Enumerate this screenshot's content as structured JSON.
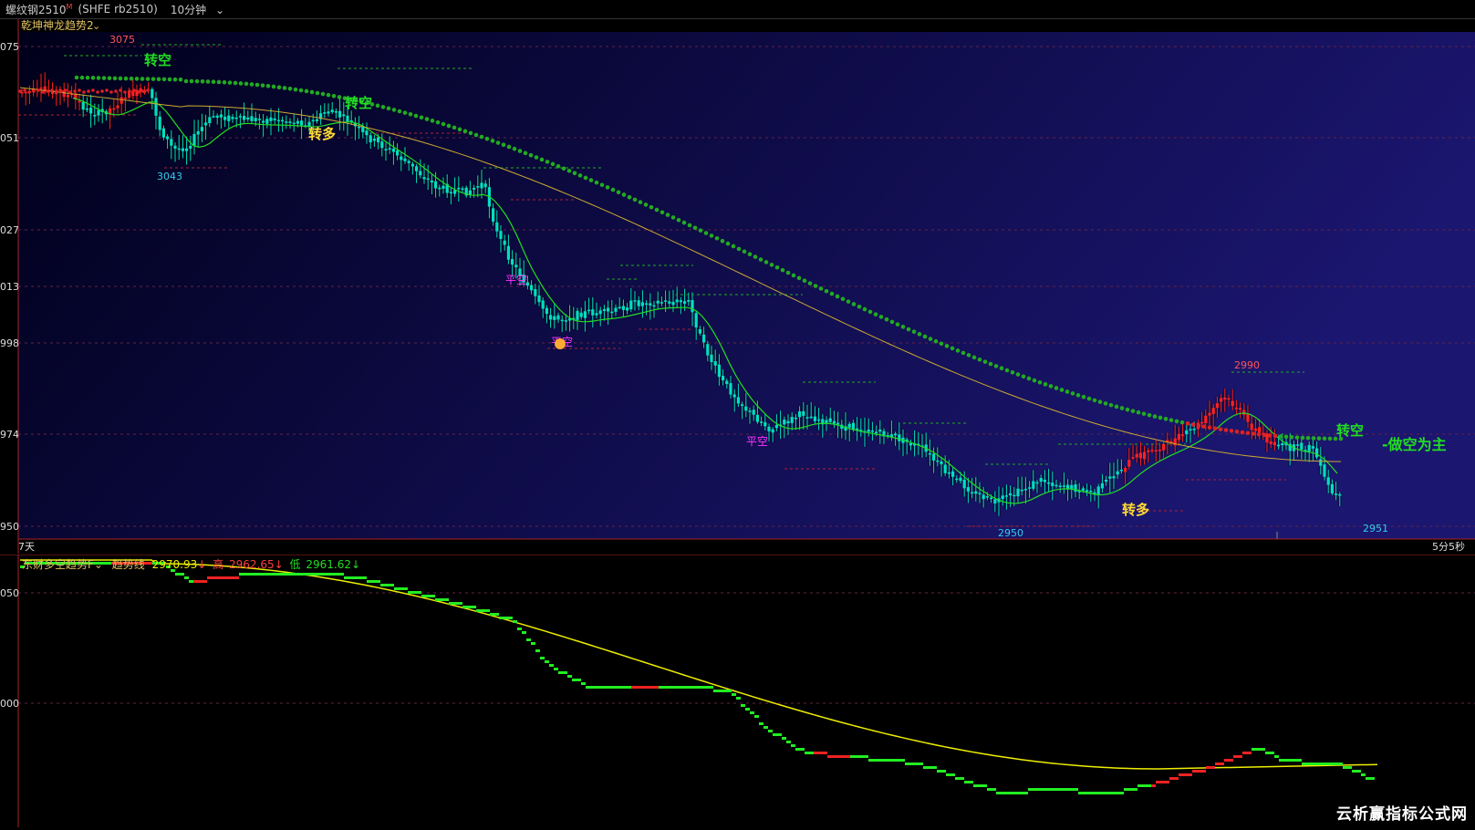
{
  "header": {
    "symbol": "螺纹钢2510",
    "symbol_sup": "M",
    "code": "(SHFE rb2510)",
    "interval": "10分钟"
  },
  "main_indicator": {
    "name": "乾坤神龙趋势2",
    "price_axis": [
      "075",
      "051",
      "027",
      "013",
      "998",
      "974",
      "950"
    ],
    "left_bottom_label": "7天",
    "right_bottom_label": "5分5秒",
    "annotations": {
      "high_label": "3075",
      "low1_label": "3043",
      "low2_label": "2950",
      "high2_label": "2990",
      "last_low_label": "2951",
      "zhuankong_1": "转空",
      "zhuankong_2": "转空",
      "zhuankong_3": "转空",
      "zhuanduo_1": "转多",
      "zhuanduo_2": "转多",
      "pingkong_1": "平空",
      "pingkong_2": "平空",
      "pingkong_3": "平空",
      "zuokong": "-做空为主"
    }
  },
  "sub_indicator": {
    "name": "东财多空趋势F",
    "line_label": "趋势线",
    "line_value": "2970.93",
    "high_label": "高",
    "high_value": "2962.65",
    "low_label": "低",
    "low_value": "2961.62",
    "price_axis": [
      "050",
      "000"
    ]
  },
  "colors": {
    "up": "#ff2020",
    "down": "#00e0c0",
    "dots": "#22aa22",
    "ma_green": "#22dd22",
    "ma_yellow": "#ccaa33",
    "sub_yellow": "#eeee00",
    "bg_top": "#000028",
    "bg_bottom": "#1a1466"
  },
  "watermark": "云析赢指标公式网"
}
